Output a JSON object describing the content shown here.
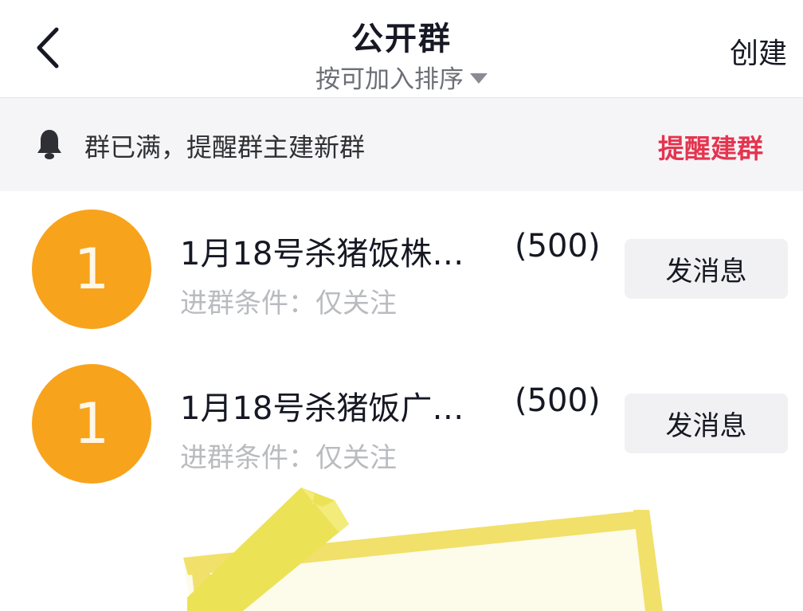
{
  "header": {
    "title": "公开群",
    "sort_label": "按可加入排序",
    "create_label": "创建"
  },
  "notice": {
    "text": "群已满，提醒群主建新群",
    "action_label": "提醒建群"
  },
  "groups": [
    {
      "avatar_text": "1",
      "name": "1月18号杀猪饭株…",
      "count": "(500)",
      "condition": "进群条件：仅关注",
      "button_label": "发消息"
    },
    {
      "avatar_text": "1",
      "name": "1月18号杀猪饭广…",
      "count": "(500)",
      "condition": "进群条件：仅关注",
      "button_label": "发消息"
    }
  ],
  "colors": {
    "accent_red": "#e5344f",
    "avatar_orange": "#f8a31c"
  }
}
